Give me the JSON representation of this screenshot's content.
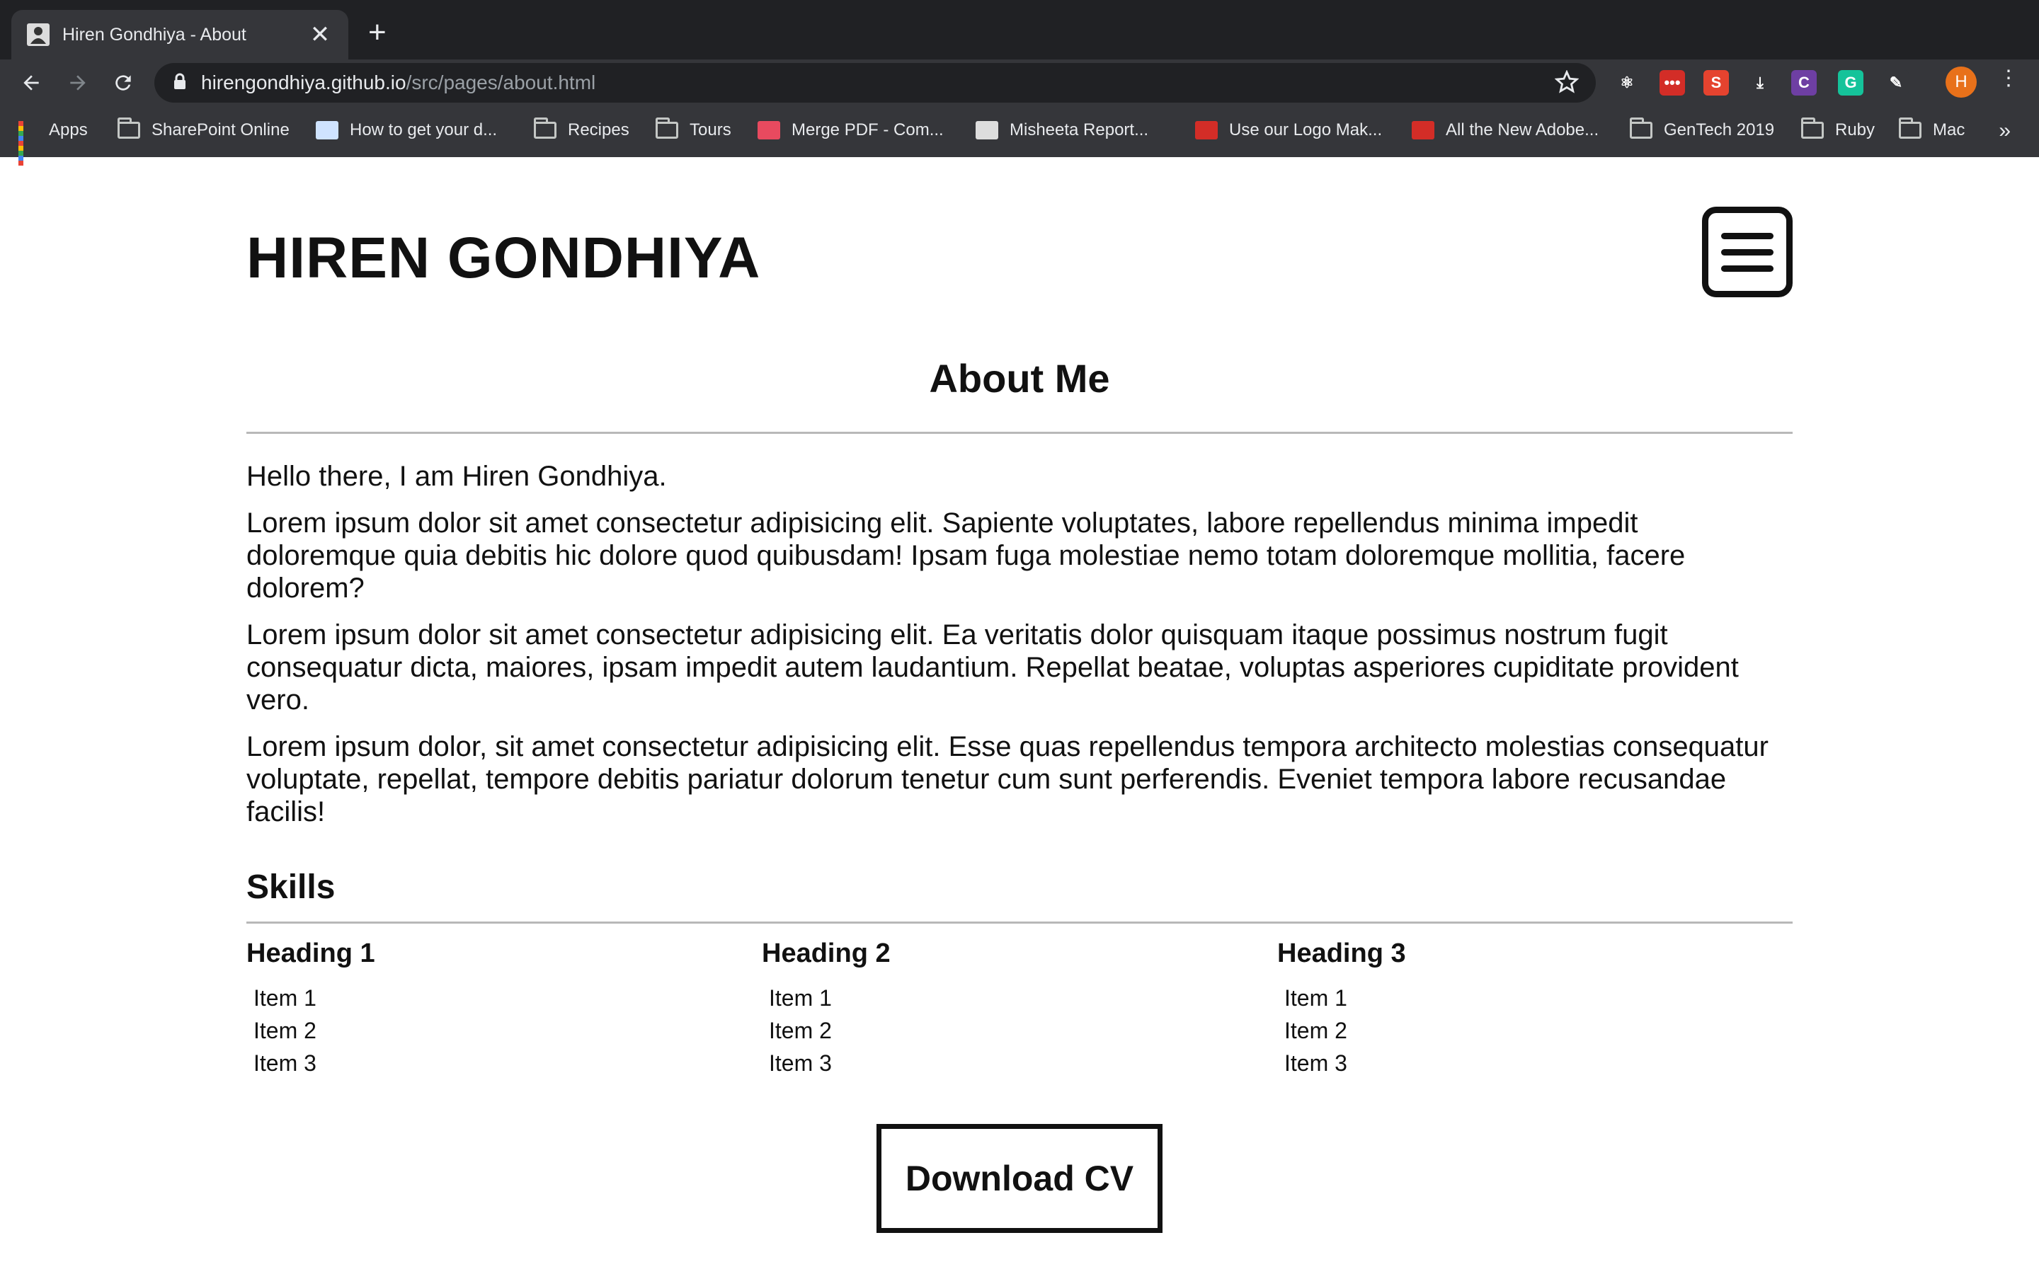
{
  "browser": {
    "tab": {
      "title": "Hiren Gondhiya - About",
      "close": "✕"
    },
    "new_tab": "+",
    "url": {
      "domain": "hirengondhiya.github.io",
      "path": "/src/pages/about.html"
    },
    "profile_initial": "H",
    "menu": "⋮",
    "extensions": [
      {
        "name": "react-devtools-icon",
        "color": "#35363a",
        "label": "⚛"
      },
      {
        "name": "lastpass-icon",
        "color": "#d32d27",
        "label": "•••"
      },
      {
        "name": "s-extension-icon",
        "color": "#e5432f",
        "label": "S"
      },
      {
        "name": "download-icon",
        "color": "#35363a",
        "label": "⤓"
      },
      {
        "name": "c-extension-icon",
        "color": "#6e3fa3",
        "label": "C"
      },
      {
        "name": "grammarly-icon",
        "color": "#15c39a",
        "label": "G"
      },
      {
        "name": "color-picker-icon",
        "color": "#35363a",
        "label": "✎"
      }
    ],
    "bookmarks": [
      {
        "label": "Apps",
        "icon": "apps-grid-icon"
      },
      {
        "label": "SharePoint Online",
        "icon": "folder-icon"
      },
      {
        "label": "How to get your d...",
        "icon": "page-icon"
      },
      {
        "label": "Recipes",
        "icon": "folder-icon"
      },
      {
        "label": "Tours",
        "icon": "folder-icon"
      },
      {
        "label": "Merge PDF - Com...",
        "icon": "pdf-merge-icon"
      },
      {
        "label": "Misheeta Report...",
        "icon": "report-icon"
      },
      {
        "label": "Use our Logo Mak...",
        "icon": "logo-maker-icon"
      },
      {
        "label": "All the New Adobe...",
        "icon": "p-icon"
      },
      {
        "label": "GenTech 2019",
        "icon": "folder-icon"
      },
      {
        "label": "Ruby",
        "icon": "folder-icon"
      },
      {
        "label": "Mac",
        "icon": "folder-icon"
      }
    ],
    "more_bookmarks": "»"
  },
  "site": {
    "title": "HIREN GONDHIYA",
    "about_heading": "About Me",
    "paragraphs": [
      "Hello there, I am Hiren Gondhiya.",
      "Lorem ipsum dolor sit amet consectetur adipisicing elit. Sapiente voluptates, labore repellendus minima impedit doloremque quia debitis hic dolore quod quibusdam! Ipsam fuga molestiae nemo totam doloremque mollitia, facere dolorem?",
      "Lorem ipsum dolor sit amet consectetur adipisicing elit. Ea veritatis dolor quisquam itaque possimus nostrum fugit consequatur dicta, maiores, ipsam impedit autem laudantium. Repellat beatae, voluptas asperiores cupiditate provident vero.",
      "Lorem ipsum dolor, sit amet consectetur adipisicing elit. Esse quas repellendus tempora architecto molestias consequatur voluptate, repellat, tempore debitis pariatur dolorum tenetur cum sunt perferendis. Eveniet tempora labore recusandae facilis!"
    ],
    "skills_heading": "Skills",
    "skills": [
      {
        "heading": "Heading 1",
        "items": [
          "Item 1",
          "Item 2",
          "Item 3"
        ]
      },
      {
        "heading": "Heading 2",
        "items": [
          "Item 1",
          "Item 2",
          "Item 3"
        ]
      },
      {
        "heading": "Heading 3",
        "items": [
          "Item 1",
          "Item 2",
          "Item 3"
        ]
      }
    ],
    "cv_button": "Download CV"
  }
}
